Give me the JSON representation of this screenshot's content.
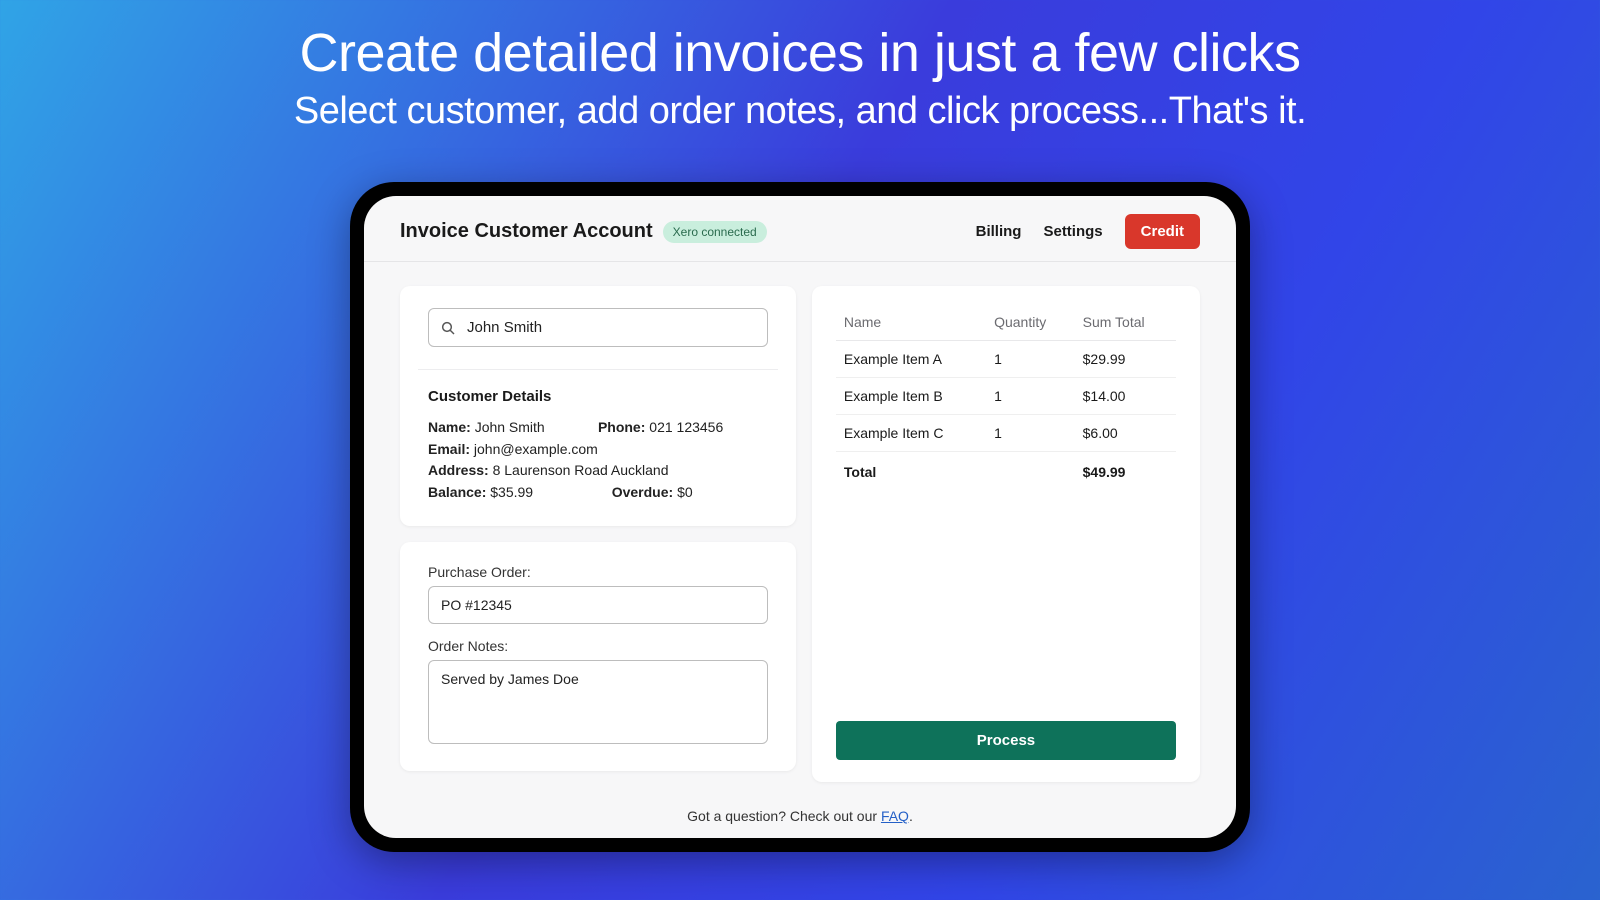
{
  "hero": {
    "title": "Create detailed invoices in just a few clicks",
    "subtitle": "Select customer, add order notes, and click process...That's it."
  },
  "header": {
    "title": "Invoice Customer Account",
    "badge": "Xero connected",
    "nav": {
      "billing": "Billing",
      "settings": "Settings"
    },
    "credit_button": "Credit"
  },
  "search": {
    "value": "John Smith"
  },
  "customer": {
    "section_title": "Customer Details",
    "labels": {
      "name": "Name:",
      "phone": "Phone:",
      "email": "Email:",
      "address": "Address:",
      "balance": "Balance:",
      "overdue": "Overdue:"
    },
    "name": "John Smith",
    "phone": "021 123456",
    "email": "john@example.com",
    "address": "8 Laurenson Road Auckland",
    "balance": "$35.99",
    "overdue": "$0"
  },
  "order_form": {
    "po_label": "Purchase Order:",
    "po_value": "PO #12345",
    "notes_label": "Order Notes:",
    "notes_value": "Served by James Doe"
  },
  "line_items": {
    "columns": {
      "name": "Name",
      "qty": "Quantity",
      "sum": "Sum Total"
    },
    "rows": [
      {
        "name": "Example Item A",
        "qty": "1",
        "sum": "$29.99"
      },
      {
        "name": "Example Item B",
        "qty": "1",
        "sum": "$14.00"
      },
      {
        "name": "Example Item C",
        "qty": "1",
        "sum": "$6.00"
      }
    ],
    "total_label": "Total",
    "total_value": "$49.99"
  },
  "process_button": "Process",
  "footer": {
    "prefix": "Got a question? Check out our ",
    "link": "FAQ",
    "suffix": "."
  }
}
